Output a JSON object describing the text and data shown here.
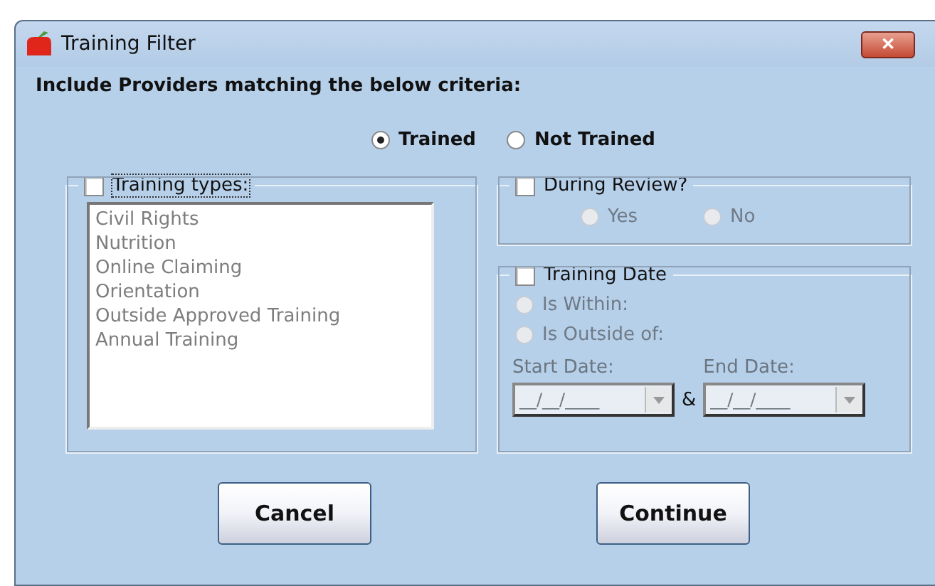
{
  "window": {
    "title": "Training Filter",
    "close": "✕"
  },
  "heading": "Include Providers matching the below criteria:",
  "status_options": [
    {
      "label": "Trained",
      "selected": true
    },
    {
      "label": "Not Trained",
      "selected": false
    }
  ],
  "training_types": {
    "label": "Training types:",
    "checked": false,
    "disabled": true,
    "items": [
      "Civil Rights",
      "Nutrition",
      "Online Claiming",
      "Orientation",
      "Outside Approved Training",
      "Annual Training"
    ]
  },
  "during_review": {
    "label": "During Review?",
    "checked": false,
    "disabled": true,
    "options": [
      {
        "label": "Yes",
        "selected": false
      },
      {
        "label": "No",
        "selected": false
      }
    ]
  },
  "training_date": {
    "label": "Training Date",
    "checked": false,
    "disabled": true,
    "options": [
      {
        "label": "Is Within:",
        "selected": false
      },
      {
        "label": "Is Outside of:",
        "selected": false
      }
    ],
    "start_label": "Start Date:",
    "start_value": "__/__/____",
    "separator": "&",
    "end_label": "End Date:",
    "end_value": "__/__/____"
  },
  "buttons": [
    "Cancel",
    "Continue"
  ]
}
